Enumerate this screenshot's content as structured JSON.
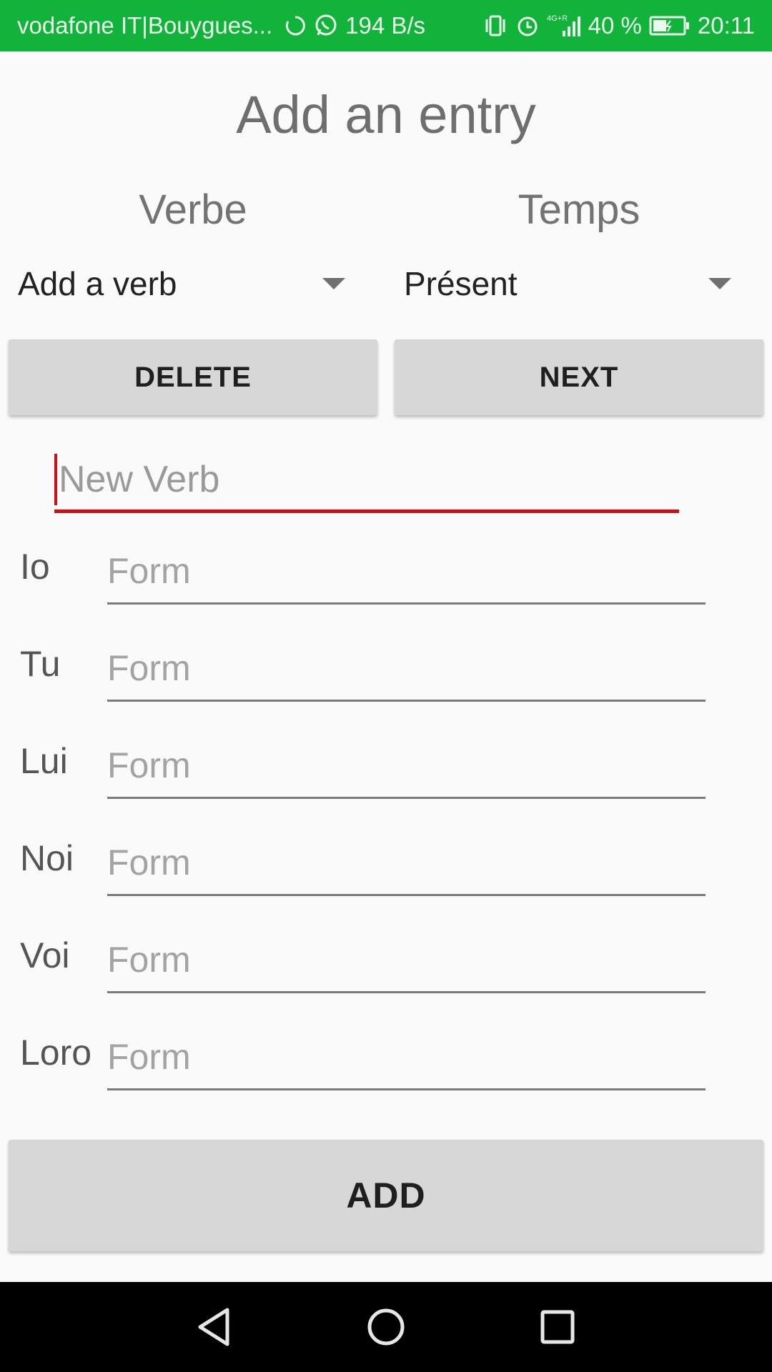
{
  "status_bar": {
    "carrier": "vodafone IT|Bouygues...",
    "speed": "194 B/s",
    "battery": "40 %",
    "time": "20:11",
    "network": "4G+R",
    "background_color": "#12b33a"
  },
  "title": "Add an entry",
  "columns": {
    "verb_header": "Verbe",
    "tense_header": "Temps"
  },
  "spinners": {
    "verb_selected": "Add a verb",
    "tense_selected": "Présent"
  },
  "buttons": {
    "delete": "DELETE",
    "next": "NEXT",
    "add": "ADD"
  },
  "new_verb": {
    "placeholder": "New Verb",
    "accent_color": "#cc1013"
  },
  "forms": [
    {
      "pronoun": "Io",
      "placeholder": "Form"
    },
    {
      "pronoun": "Tu",
      "placeholder": "Form"
    },
    {
      "pronoun": "Lui",
      "placeholder": "Form"
    },
    {
      "pronoun": "Noi",
      "placeholder": "Form"
    },
    {
      "pronoun": "Voi",
      "placeholder": "Form"
    },
    {
      "pronoun": "Loro",
      "placeholder": "Form"
    }
  ],
  "nav_icons": [
    "back-icon",
    "home-icon",
    "recents-icon"
  ]
}
